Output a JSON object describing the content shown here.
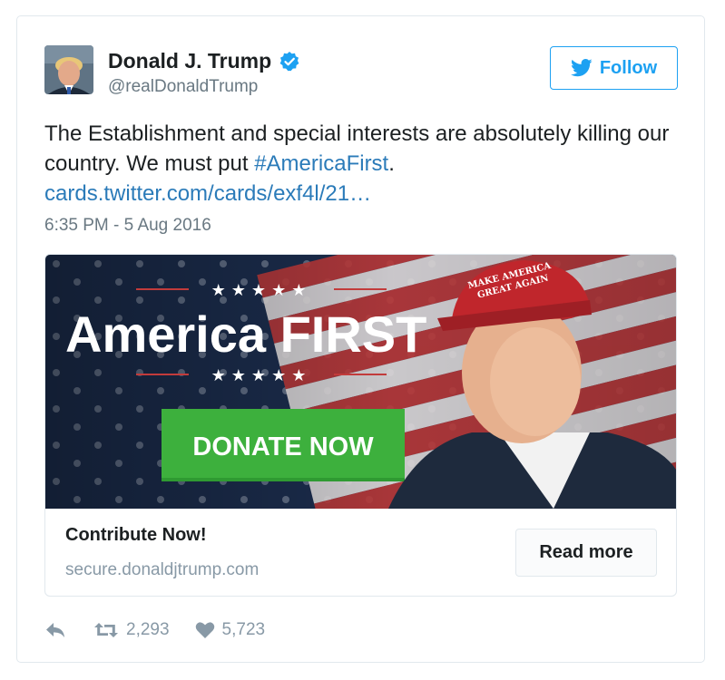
{
  "tweet": {
    "author": {
      "display_name": "Donald J. Trump",
      "screen_name": "@realDonaldTrump",
      "verified": true,
      "avatar_icon": "profile-photo"
    },
    "follow_label": "Follow",
    "text_part1": "The Establishment and special interests are absolutely killing our country. We must put ",
    "hashtag": "#AmericaFirst",
    "text_part2": ".",
    "link": "cards.twitter.com/cards/exf4l/21…",
    "timestamp": "6:35 PM - 5 Aug 2016",
    "card": {
      "image": {
        "headline_a": "America ",
        "headline_b": "FIRST",
        "button_text": "DONATE NOW",
        "hat_line1": "MAKE AMERICA",
        "hat_line2": "GREAT AGAIN"
      },
      "title": "Contribute Now!",
      "domain": "secure.donaldjtrump.com",
      "cta_label": "Read more"
    },
    "stats": {
      "retweets": "2,293",
      "likes": "5,723"
    },
    "icons": {
      "reply": "reply-icon",
      "retweet": "retweet-icon",
      "like": "heart-icon",
      "verified": "verified-badge-icon",
      "follow": "twitter-bird-icon"
    },
    "colors": {
      "accent": "#1da1f2",
      "link": "#2b7bb9",
      "muted": "#697882",
      "donate_green": "#3db03d"
    }
  }
}
